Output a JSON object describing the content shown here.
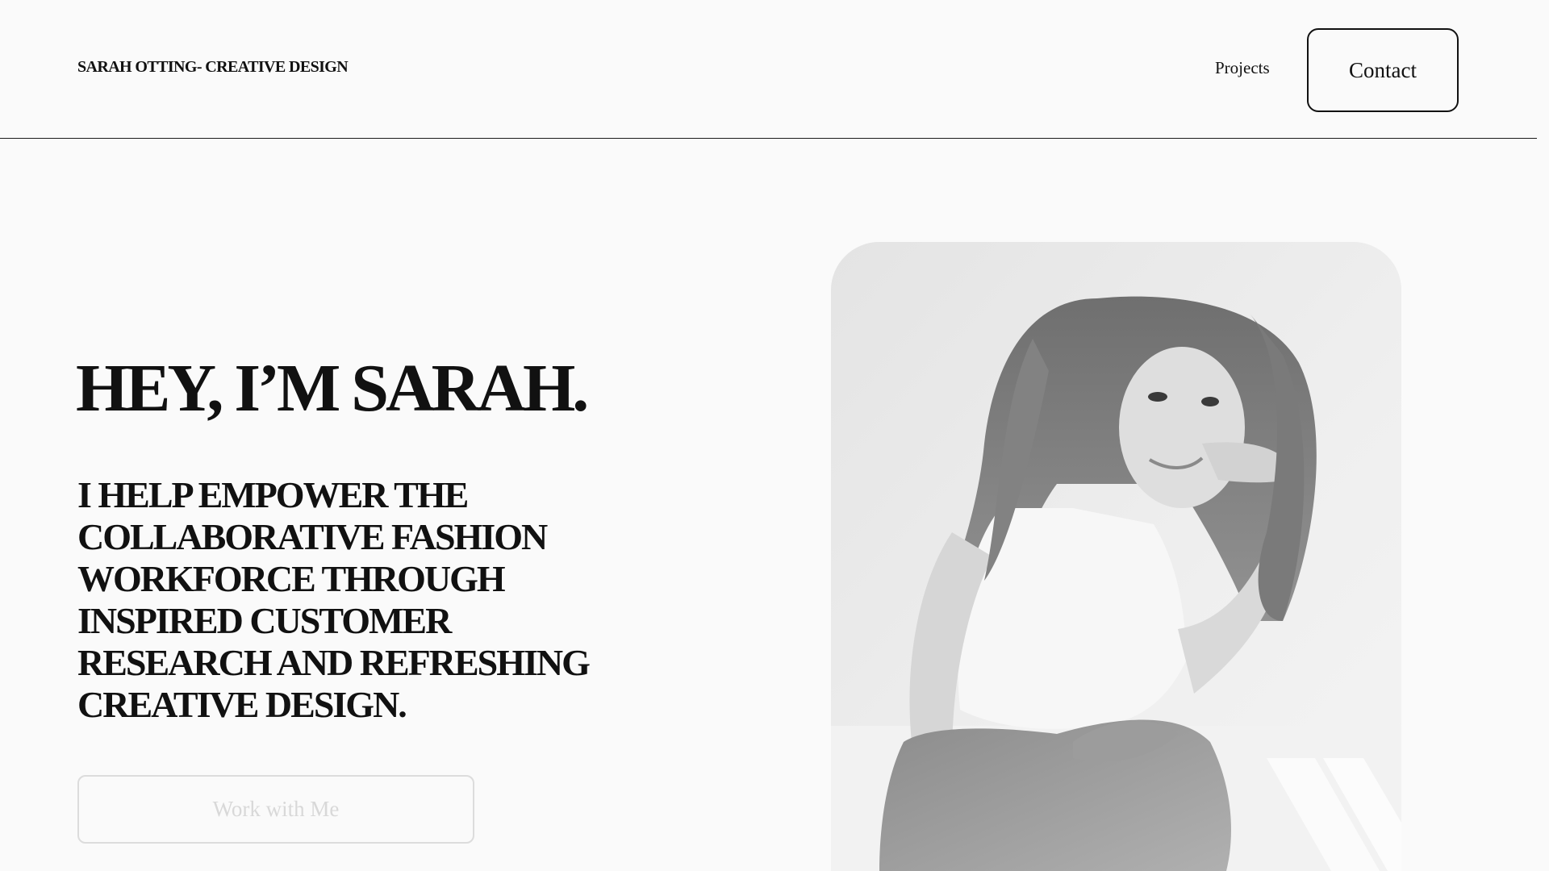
{
  "header": {
    "brand": "SARAH OTTING- CREATIVE DESIGN",
    "nav": {
      "projects_label": "Projects",
      "contact_label": "Contact"
    }
  },
  "hero": {
    "title": "HEY, I’M SARAH.",
    "subtitle": "I HELP EMPOWER THE COLLABORATIVE FASHION WORKFORCE THROUGH INSPIRED CUSTOMER RESEARCH AND REFRESHING CREATIVE DESIGN.",
    "cta_label": "Work with Me"
  },
  "portrait": {
    "icon": "portrait-photo",
    "style": "black-and-white"
  },
  "colors": {
    "background": "#fafafa",
    "text": "#111111",
    "muted_button_text": "#d8d8d8",
    "muted_border": "#dcdcdc"
  }
}
